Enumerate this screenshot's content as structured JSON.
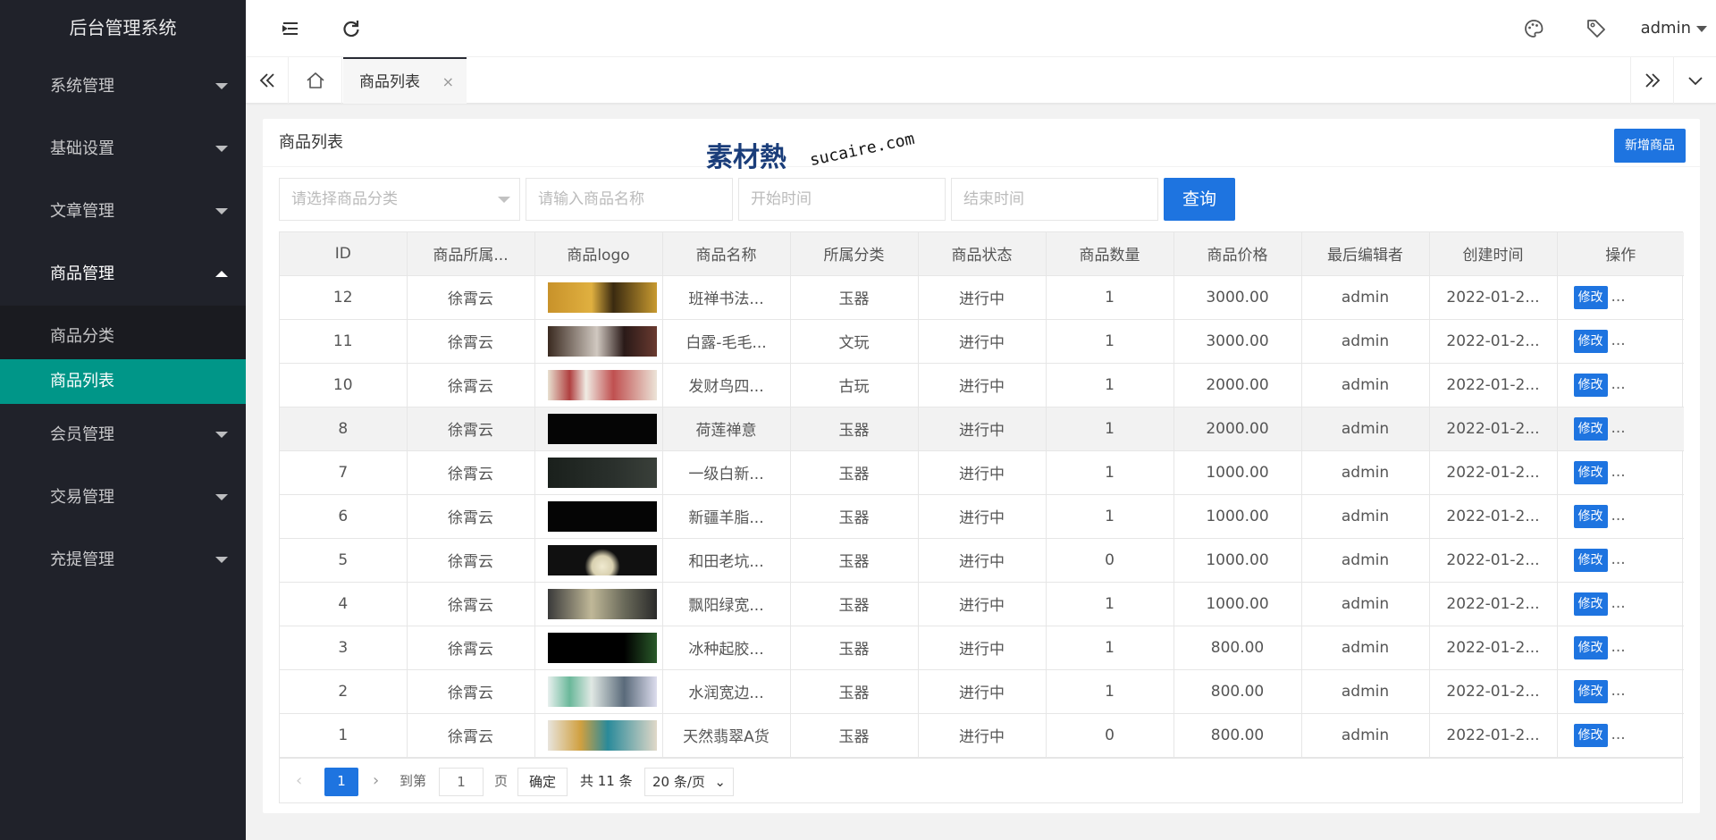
{
  "app": {
    "title": "后台管理系统"
  },
  "sidebar": {
    "items": [
      {
        "label": "系统管理"
      },
      {
        "label": "基础设置"
      },
      {
        "label": "文章管理"
      },
      {
        "label": "商品管理"
      },
      {
        "label": "会员管理"
      },
      {
        "label": "交易管理"
      },
      {
        "label": "充提管理"
      }
    ],
    "submenu": [
      {
        "label": "商品分类"
      },
      {
        "label": "商品列表"
      }
    ]
  },
  "header": {
    "user": "admin"
  },
  "tabs": {
    "active": "商品列表",
    "close": "×"
  },
  "card": {
    "title": "商品列表",
    "add_label": "新增商品"
  },
  "watermark": {
    "cn": "素材熱",
    "en": "sucaire.com"
  },
  "filters": {
    "category_placeholder": "请选择商品分类",
    "name_placeholder": "请输入商品名称",
    "start_placeholder": "开始时间",
    "end_placeholder": "结束时间",
    "search_label": "查询"
  },
  "table": {
    "headers": [
      "ID",
      "商品所属...",
      "商品logo",
      "商品名称",
      "所属分类",
      "商品状态",
      "商品数量",
      "商品价格",
      "最后编辑者",
      "创建时间",
      "操作"
    ],
    "edit_label": "修改",
    "more_label": "...",
    "rows": [
      {
        "id": "12",
        "owner": "徐霄云",
        "name": "班禅书法...",
        "category": "玉器",
        "status": "进行中",
        "qty": "1",
        "price": "3000.00",
        "editor": "admin",
        "created": "2022-01-2..."
      },
      {
        "id": "11",
        "owner": "徐霄云",
        "name": "白露-毛毛...",
        "category": "文玩",
        "status": "进行中",
        "qty": "1",
        "price": "3000.00",
        "editor": "admin",
        "created": "2022-01-2..."
      },
      {
        "id": "10",
        "owner": "徐霄云",
        "name": "发财鸟四...",
        "category": "古玩",
        "status": "进行中",
        "qty": "1",
        "price": "2000.00",
        "editor": "admin",
        "created": "2022-01-2..."
      },
      {
        "id": "8",
        "owner": "徐霄云",
        "name": "荷莲禅意",
        "category": "玉器",
        "status": "进行中",
        "qty": "1",
        "price": "2000.00",
        "editor": "admin",
        "created": "2022-01-2..."
      },
      {
        "id": "7",
        "owner": "徐霄云",
        "name": "一级白新...",
        "category": "玉器",
        "status": "进行中",
        "qty": "1",
        "price": "1000.00",
        "editor": "admin",
        "created": "2022-01-2..."
      },
      {
        "id": "6",
        "owner": "徐霄云",
        "name": "新疆羊脂...",
        "category": "玉器",
        "status": "进行中",
        "qty": "1",
        "price": "1000.00",
        "editor": "admin",
        "created": "2022-01-2..."
      },
      {
        "id": "5",
        "owner": "徐霄云",
        "name": "和田老坑...",
        "category": "玉器",
        "status": "进行中",
        "qty": "0",
        "price": "1000.00",
        "editor": "admin",
        "created": "2022-01-2..."
      },
      {
        "id": "4",
        "owner": "徐霄云",
        "name": "飘阳绿宽...",
        "category": "玉器",
        "status": "进行中",
        "qty": "1",
        "price": "1000.00",
        "editor": "admin",
        "created": "2022-01-2..."
      },
      {
        "id": "3",
        "owner": "徐霄云",
        "name": "冰种起胶...",
        "category": "玉器",
        "status": "进行中",
        "qty": "1",
        "price": "800.00",
        "editor": "admin",
        "created": "2022-01-2..."
      },
      {
        "id": "2",
        "owner": "徐霄云",
        "name": "水润宽边...",
        "category": "玉器",
        "status": "进行中",
        "qty": "1",
        "price": "800.00",
        "editor": "admin",
        "created": "2022-01-2..."
      },
      {
        "id": "1",
        "owner": "徐霄云",
        "name": "天然翡翠A货",
        "category": "玉器",
        "status": "进行中",
        "qty": "0",
        "price": "800.00",
        "editor": "admin",
        "created": "2022-01-2..."
      }
    ]
  },
  "pager": {
    "current": "1",
    "goto_label": "到第",
    "goto_value": "1",
    "page_unit": "页",
    "confirm_label": "确定",
    "total_label": "共 11 条",
    "size_label": "20 条/页"
  },
  "colors": {
    "sidebar": "#20222a",
    "active": "#009688",
    "primary": "#1e74e0"
  }
}
